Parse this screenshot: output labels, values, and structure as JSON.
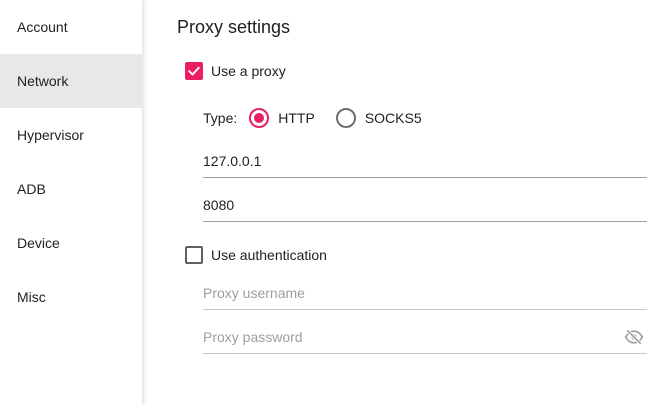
{
  "sidebar": {
    "items": [
      {
        "label": "Account"
      },
      {
        "label": "Network"
      },
      {
        "label": "Hypervisor"
      },
      {
        "label": "ADB"
      },
      {
        "label": "Device"
      },
      {
        "label": "Misc"
      }
    ],
    "active_index": 1
  },
  "main": {
    "title": "Proxy settings",
    "use_proxy": {
      "label": "Use a proxy",
      "checked": true
    },
    "type": {
      "label": "Type:",
      "options": [
        {
          "label": "HTTP",
          "selected": true
        },
        {
          "label": "SOCKS5",
          "selected": false
        }
      ]
    },
    "host": {
      "value": "127.0.0.1"
    },
    "port": {
      "value": "8080"
    },
    "use_auth": {
      "label": "Use authentication",
      "checked": false
    },
    "username": {
      "placeholder": "Proxy username",
      "value": ""
    },
    "password": {
      "placeholder": "Proxy password",
      "value": "",
      "toggle_icon": "eye-off-icon"
    }
  },
  "colors": {
    "accent": "#e91e63",
    "sidebar_active_bg": "#e8e8e8",
    "divider": "#9e9e9e"
  }
}
